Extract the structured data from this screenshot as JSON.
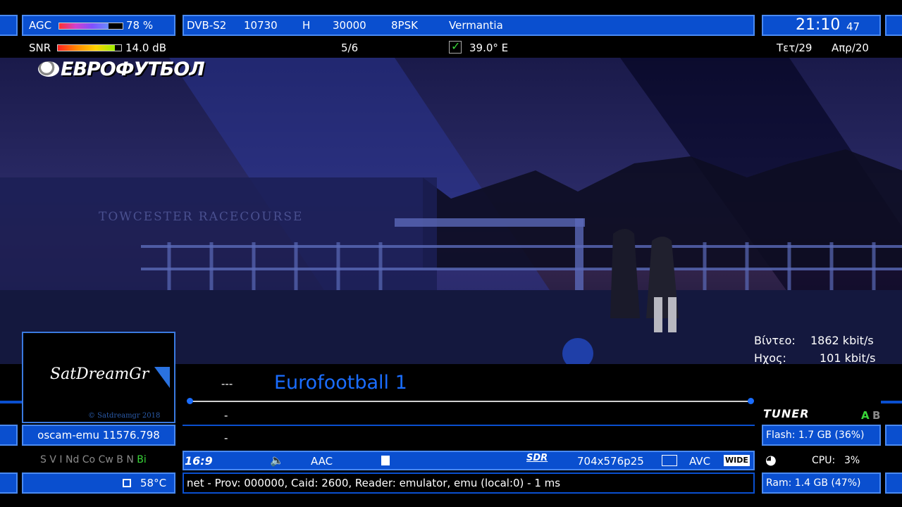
{
  "signal": {
    "agc_label": "AGC",
    "agc_value": "78 %",
    "agc_fraction": 0.78,
    "snr_label": "SNR",
    "snr_value": "14.0 dB",
    "snr_fraction": 0.9
  },
  "transponder": {
    "system": "DVB-S2",
    "frequency": "10730",
    "polarization": "H",
    "symbol_rate": "30000",
    "modulation": "8PSK",
    "provider": "Vermantia",
    "fec": "5/6",
    "orbital": "39.0° E"
  },
  "clock": {
    "time": "21:10",
    "seconds": "47",
    "weekday": "Τετ/29",
    "month": "Απρ/20"
  },
  "channel_logo": "ЕВРОФУТБОЛ",
  "watermark_text": "TOWCESTER RACECOURSE",
  "bitrate": {
    "video_label": "Βίντεο:",
    "video_value": "1862 kbit/s",
    "audio_label": "Ηχος:",
    "audio_value": "101 kbit/s"
  },
  "picon": {
    "name": "SatDreamGr",
    "copyright": "© Satdreamgr 2018"
  },
  "channel": {
    "number": "---",
    "name": "Eurofootball 1",
    "event_now": "-",
    "event_next": "-",
    "progress": 1.0
  },
  "cam": {
    "softcam": "oscam-emu 11576.798",
    "systems": [
      "S",
      "V",
      "I",
      "Nd",
      "Co",
      "Cw",
      "B",
      "N",
      "Bi"
    ],
    "active_system": "Bi",
    "temperature": "58°C"
  },
  "tuner": {
    "label": "TUNER",
    "a": "A",
    "b": "B"
  },
  "system_info": {
    "flash": "Flash: 1.7 GB (36%)",
    "cpu_label": "CPU:",
    "cpu_value": "3%",
    "ram": "Ram: 1.4 GB (47%)"
  },
  "stream": {
    "aspect": "16:9",
    "audio_codec": "AAC",
    "sdr": "SDR",
    "resolution": "704x576p25",
    "video_codec": "AVC",
    "wide": "WIDE"
  },
  "ecm": "net - Prov: 000000, Caid: 2600, Reader: emulator, emu (local:0) - 1 ms",
  "colors": {
    "panel_blue": "#0a4fcf",
    "panel_border": "#4a8af2",
    "accent_text": "#1a6dff",
    "active_green": "#39d639"
  }
}
